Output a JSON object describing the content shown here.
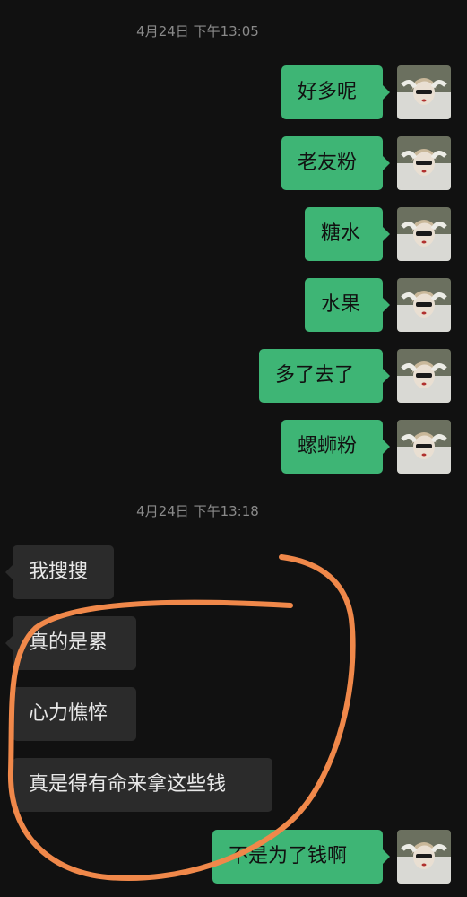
{
  "chat": {
    "timestamp1": "4月24日 下午13:05",
    "timestamp2": "4月24日 下午13:18"
  },
  "messages": [
    {
      "side": "sent",
      "text": "好多呢"
    },
    {
      "side": "sent",
      "text": "老友粉"
    },
    {
      "side": "sent",
      "text": "糖水"
    },
    {
      "side": "sent",
      "text": "水果"
    },
    {
      "side": "sent",
      "text": "多了去了"
    },
    {
      "side": "sent",
      "text": "螺蛳粉"
    },
    {
      "side": "received",
      "text": "我搜搜"
    },
    {
      "side": "received",
      "text": "真的是累"
    },
    {
      "side": "received",
      "text": "心力憔悴"
    },
    {
      "side": "received",
      "text": "真是得有命来拿这些钱"
    },
    {
      "side": "sent",
      "text": "不是为了钱啊"
    }
  ],
  "colors": {
    "background": "#111111",
    "sent_bubble": "#3eb575",
    "received_bubble": "#2b2b2b",
    "annotation_circle": "#f0884a"
  },
  "icons": {
    "avatar": "user-avatar-photo"
  }
}
